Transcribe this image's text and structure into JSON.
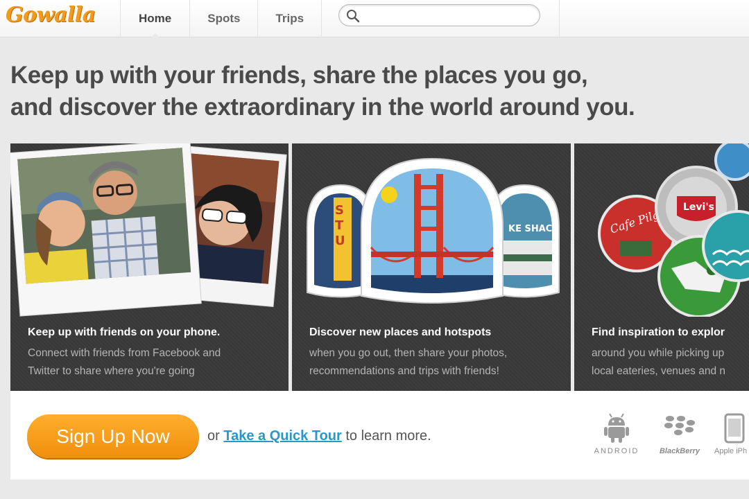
{
  "header": {
    "logo_text": "Gowalla",
    "nav": [
      {
        "label": "Home",
        "active": true
      },
      {
        "label": "Spots",
        "active": false
      },
      {
        "label": "Trips",
        "active": false
      }
    ],
    "search": {
      "placeholder": "",
      "value": "",
      "icon": "search-icon"
    }
  },
  "headline": {
    "line1": "Keep up with your friends, share the places you go,",
    "line2": "and discover the extraordinary in the world around you."
  },
  "panels": [
    {
      "title": "Keep up with friends on your phone.",
      "desc_line1": "Connect with friends from Facebook and",
      "desc_line2": "Twitter to share where you're going",
      "icon": "photo-polaroids"
    },
    {
      "title": "Discover new places and hotspots",
      "desc_line1": "when you go out, then share your photos,",
      "desc_line2": "recommendations and trips with friends!",
      "icon": "spot-badges"
    },
    {
      "title": "Find inspiration to explor",
      "desc_line1": "around you while picking up",
      "desc_line2": "local eateries, venues and n",
      "icon": "pin-badges"
    }
  ],
  "cta": {
    "signup_label": "Sign Up Now",
    "prefix": "or",
    "tour_link": "Take a Quick Tour",
    "suffix": "to learn more."
  },
  "platforms": [
    {
      "label": "ANDROID",
      "icon": "android-icon"
    },
    {
      "label": "BlackBerry",
      "icon": "blackberry-icon"
    },
    {
      "label": "Apple iPh",
      "icon": "iphone-icon"
    }
  ],
  "colors": {
    "brand_orange": "#f29a1b",
    "link_blue": "#2a97c9",
    "panel_dark": "#3d3d3d",
    "background": "#e9e9e9"
  }
}
